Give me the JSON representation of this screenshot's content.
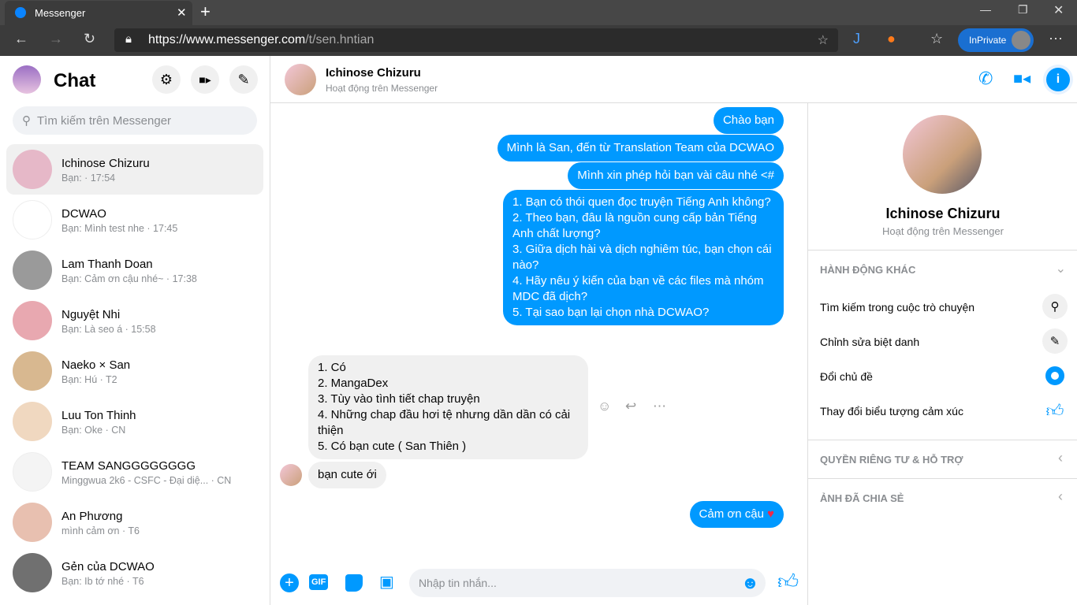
{
  "browser": {
    "tab_title": "Messenger",
    "url_host": "https://www.messenger.com",
    "url_path": "/t/sen.hntian",
    "inprivate": "InPrivate"
  },
  "sidebar": {
    "title": "Chat",
    "search_placeholder": "Tìm kiếm trên Messenger",
    "conversations": [
      {
        "name": "Ichinose Chizuru",
        "sub": "Bạn:  · 17:54",
        "color": "#e6b8c8"
      },
      {
        "name": "DCWAO",
        "sub": "Bạn: Mình test nhe · 17:45",
        "color": "#ffffff"
      },
      {
        "name": "Lam Thanh Doan",
        "sub": "Bạn: Cảm ơn cậu nhé~ · 17:38",
        "color": "#9a9a9a"
      },
      {
        "name": "Nguyệt Nhi",
        "sub": "Bạn: Là seo á · 15:58",
        "color": "#e8a8b0"
      },
      {
        "name": "Naeko × San",
        "sub": "Bạn: Hú · T2",
        "color": "#d8b890"
      },
      {
        "name": "Luu Ton Thinh",
        "sub": "Bạn: Oke · CN",
        "color": "#f0d8c0"
      },
      {
        "name": "TEAM SANGGGGGGGG",
        "sub": "Minggwua 2k6 - CSFC - Đại diệ... · CN",
        "color": "#f4f4f4"
      },
      {
        "name": "An Phương",
        "sub": "mình cảm ơn · T6",
        "color": "#e8c0b0"
      },
      {
        "name": "Gẻn của DCWAO",
        "sub": "Bạn: Ib tớ nhé · T6",
        "color": "#707070"
      }
    ]
  },
  "chat": {
    "name": "Ichinose Chizuru",
    "status": "Hoạt động trên Messenger",
    "outgoing": [
      "Chào bạn",
      "Mình là San, đến từ Translation Team của DCWAO",
      "Mình xin phép hỏi bạn vài câu nhé <#"
    ],
    "questions": [
      "1. Bạn có thói quen đọc truyện Tiếng Anh không?",
      "2. Theo bạn, đâu là nguồn cung cấp bản Tiếng Anh chất lượng?",
      "3. Giữa dịch hài và dịch nghiêm túc, bạn chọn cái nào?",
      "4. Hãy nêu ý kiến của bạn về các files mà nhóm MDC đã dịch?",
      "5. Tại sao bạn lại chọn nhà DCWAO?"
    ],
    "answers": [
      "1. Có",
      "2. MangaDex",
      "3. Tùy vào tình tiết chap truyện",
      "4. Những chap đầu hơi tệ nhưng dần dần có cải thiện",
      "5. Có bạn cute ( San Thiên )"
    ],
    "reply": "bạn cute ới",
    "thanks": "Cảm ơn cậu",
    "composer_placeholder": "Nhập tin nhắn...",
    "accent": "#0099ff"
  },
  "info": {
    "name": "Ichinose Chizuru",
    "status": "Hoạt động trên Messenger",
    "more_actions": "HÀNH ĐỘNG KHÁC",
    "actions": [
      "Tìm kiếm trong cuộc trò chuyện",
      "Chỉnh sửa biệt danh",
      "Đổi chủ đề",
      "Thay đổi biểu tượng cảm xúc"
    ],
    "privacy": "QUYỀN RIÊNG TƯ & HỖ TRỢ",
    "shared_photos": "ẢNH ĐÃ CHIA SẺ"
  }
}
